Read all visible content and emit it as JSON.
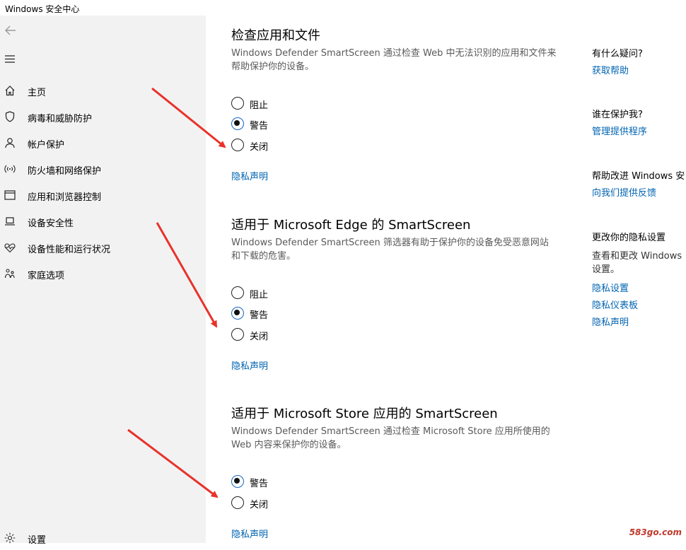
{
  "window": {
    "title": "Windows 安全中心"
  },
  "sidebar": {
    "items": [
      {
        "label": "主页",
        "icon": "home-icon"
      },
      {
        "label": "病毒和威胁防护",
        "icon": "shield-icon"
      },
      {
        "label": "帐户保护",
        "icon": "person-icon"
      },
      {
        "label": "防火墙和网络保护",
        "icon": "wifi-icon"
      },
      {
        "label": "应用和浏览器控制",
        "icon": "browser-window-icon"
      },
      {
        "label": "设备安全性",
        "icon": "laptop-icon"
      },
      {
        "label": "设备性能和运行状况",
        "icon": "heart-pulse-icon"
      },
      {
        "label": "家庭选项",
        "icon": "family-icon"
      }
    ],
    "settings_label": "设置"
  },
  "sections": [
    {
      "title": "检查应用和文件",
      "description": "Windows Defender SmartScreen 通过检查 Web 中无法识别的应用和文件来帮助保护你的设备。",
      "options": [
        {
          "label": "阻止",
          "checked": false
        },
        {
          "label": "警告",
          "checked": true
        },
        {
          "label": "关闭",
          "checked": false
        }
      ],
      "privacy_link": "隐私声明"
    },
    {
      "title": "适用于 Microsoft Edge 的 SmartScreen",
      "description": "Windows Defender SmartScreen 筛选器有助于保护你的设备免受恶意网站和下载的危害。",
      "options": [
        {
          "label": "阻止",
          "checked": false
        },
        {
          "label": "警告",
          "checked": true
        },
        {
          "label": "关闭",
          "checked": false
        }
      ],
      "privacy_link": "隐私声明"
    },
    {
      "title": "适用于 Microsoft Store 应用的 SmartScreen",
      "description": "Windows Defender SmartScreen 通过检查 Microsoft Store 应用所使用的 Web 内容来保护你的设备。",
      "options": [
        {
          "label": "警告",
          "checked": true
        },
        {
          "label": "关闭",
          "checked": false
        }
      ],
      "privacy_link": "隐私声明"
    }
  ],
  "right": {
    "question_heading": "有什么疑问?",
    "get_help": "获取帮助",
    "who_heading": "谁在保护我?",
    "manage_providers": "管理提供程序",
    "improve_heading": "帮助改进 Windows 安",
    "feedback": "向我们提供反馈",
    "privacy_heading": "更改你的隐私设置",
    "privacy_text": "查看和更改 Windows 设置。",
    "privacy_settings": "隐私设置",
    "privacy_dashboard": "隐私仪表板",
    "privacy_statement": "隐私声明"
  },
  "watermark": "583go.com",
  "colors": {
    "accent": "#0063b1",
    "arrow": "#e8322a",
    "sidebar_bg": "#f2f2f2"
  }
}
